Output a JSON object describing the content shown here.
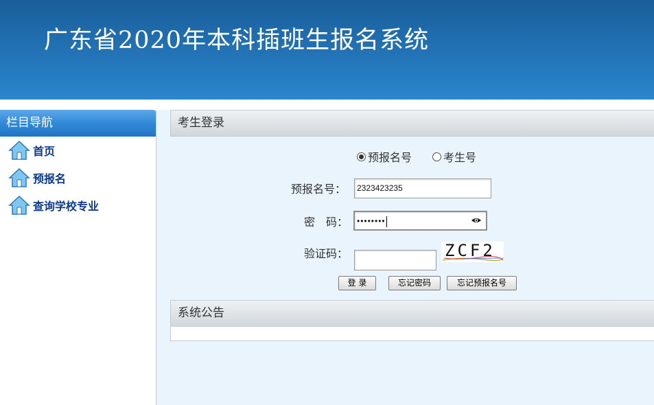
{
  "header": {
    "title": "广东省2020年本科插班生报名系统"
  },
  "sidebar": {
    "title": "栏目导航",
    "items": [
      {
        "label": "首页",
        "icon": "house-icon"
      },
      {
        "label": "预报名",
        "icon": "house-icon"
      },
      {
        "label": "查询学校专业",
        "icon": "house-icon"
      }
    ]
  },
  "login": {
    "panel_title": "考生登录",
    "radio_options": [
      {
        "label": "预报名号",
        "selected": true
      },
      {
        "label": "考生号",
        "selected": false
      }
    ],
    "fields": {
      "prereg_label": "预报名号：",
      "prereg_value": "2323423235",
      "password_label": "密　码：",
      "password_value": "••••••••",
      "captcha_label": "验证码：",
      "captcha_value": "",
      "captcha_text": "ZCF2"
    },
    "buttons": {
      "login": "登 录",
      "forgot_password": "忘记密码",
      "forgot_prereg": "忘记预报名号"
    }
  },
  "notice": {
    "panel_title": "系统公告"
  },
  "colors": {
    "banner": "#2170b2",
    "sidebar_header": "#2f86d6",
    "nav_text": "#0b3a8a",
    "page_bg": "#eaf4fc"
  }
}
